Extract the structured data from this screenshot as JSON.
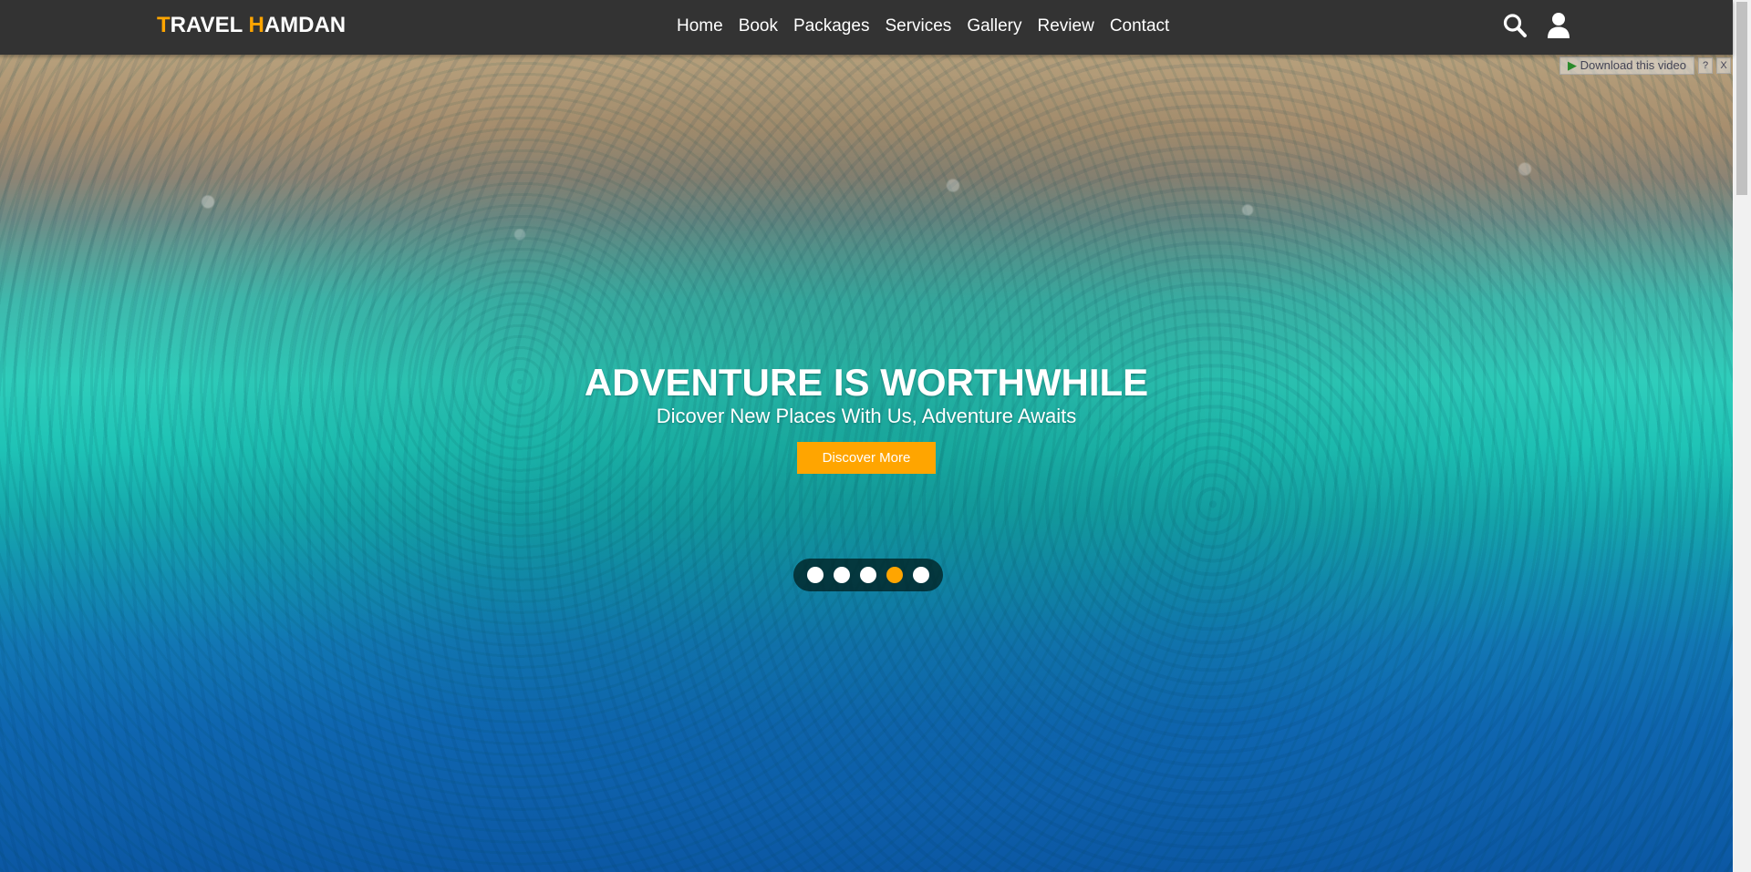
{
  "header": {
    "logo": {
      "first_accent": "T",
      "first_rest": "RAVEL ",
      "second_accent": "H",
      "second_rest": "AMDAN"
    },
    "nav": [
      "Home",
      "Book",
      "Packages",
      "Services",
      "Gallery",
      "Review",
      "Contact"
    ],
    "icons": [
      "search-icon",
      "user-icon"
    ]
  },
  "hero": {
    "title": "ADVENTURE IS WORTHWHILE",
    "subtitle": "Dicover New Places With Us, Adventure Awaits",
    "cta_label": "Discover More",
    "slides": {
      "count": 5,
      "active_index": 3
    },
    "download_overlay": {
      "label": "Download this video",
      "help": "?",
      "close": "X"
    }
  },
  "colors": {
    "accent": "#ffa500",
    "header_bg": "#333333",
    "text": "#ffffff"
  }
}
